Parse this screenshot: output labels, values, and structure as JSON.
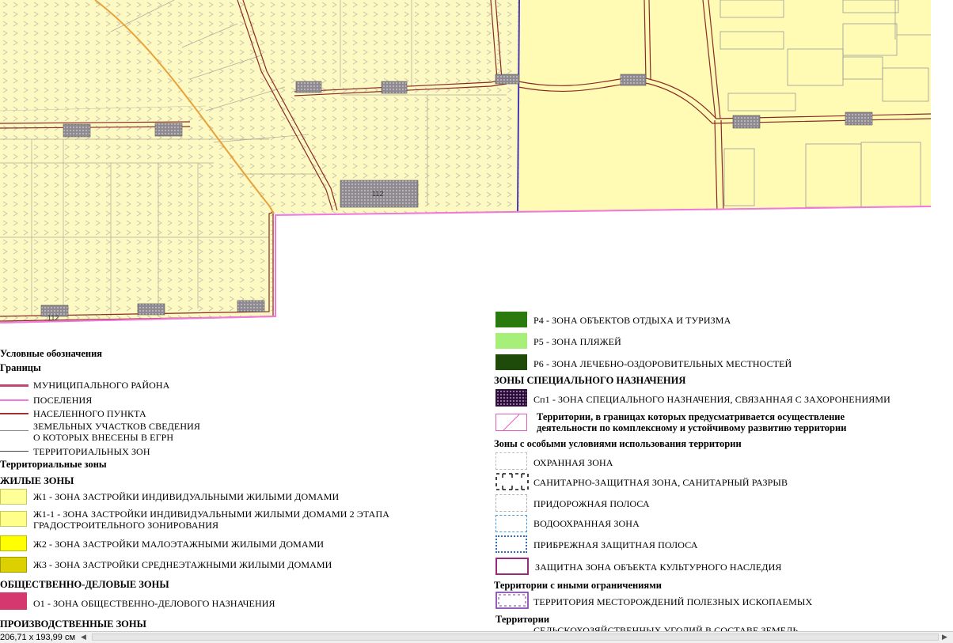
{
  "map": {
    "parcel_label_1": "112",
    "parcel_label_2": "112"
  },
  "legend": {
    "title": "Условные обозначения",
    "boundaries_heading": "Границы",
    "boundaries": [
      {
        "label": "МУНИЦИПАЛЬНОГО РАЙОНА",
        "color": "#c2466e"
      },
      {
        "label": "ПОСЕЛЕНИЯ",
        "color": "#f07ad8"
      },
      {
        "label": "НАСЕЛЕННОГО ПУНКТА",
        "color": "#a23030"
      },
      {
        "label": "ЗЕМЕЛЬНЫХ УЧАСТКОВ СВЕДЕНИЯ\nО КОТОРЫХ ВНЕСЕНЫ В ЕГРН",
        "color": "#888888"
      },
      {
        "label": "ТЕРРИТОРИАЛЬНЫХ ЗОН",
        "color": "#444444"
      }
    ],
    "territorial_heading": "Территориальные зоны",
    "residential_heading": "ЖИЛЫЕ ЗОНЫ",
    "residential": [
      {
        "label": "Ж1 - ЗОНА ЗАСТРОЙКИ ИНДИВИДУАЛЬНЫМИ ЖИЛЫМИ ДОМАМИ",
        "color": "#ffff99"
      },
      {
        "label": "Ж1-1 - ЗОНА ЗАСТРОЙКИ ИНДИВИДУАЛЬНЫМИ ЖИЛЫМИ ДОМАМИ 2 ЭТАПА\nГРАДОСТРОИТЕЛЬНОГО ЗОНИРОВАНИЯ",
        "color": "#ffff8a"
      },
      {
        "label": "Ж2 - ЗОНА ЗАСТРОЙКИ МАЛОЭТАЖНЫМИ ЖИЛЫМИ ДОМАМИ",
        "color": "#ffff00"
      },
      {
        "label": "Ж3 - ЗОНА ЗАСТРОЙКИ СРЕДНЕЭТАЖНЫМИ ЖИЛЫМИ ДОМАМИ",
        "color": "#dcd000"
      }
    ],
    "public_heading": "ОБЩЕСТВЕННО-ДЕЛОВЫЕ ЗОНЫ",
    "public": [
      {
        "label": "О1 - ЗОНА ОБЩЕСТВЕННО-ДЕЛОВОГО НАЗНАЧЕНИЯ",
        "color": "#d4386e"
      }
    ],
    "industrial_heading": "ПРОИЗВОДСТВЕННЫЕ ЗОНЫ",
    "recreation": [
      {
        "label": "Р4 - ЗОНА ОБЪЕКТОВ ОТДЫХА И ТУРИЗМА",
        "color": "#2a7a10"
      },
      {
        "label": "Р5 - ЗОНА ПЛЯЖЕЙ",
        "color": "#a6f07a"
      },
      {
        "label": "Р6 - ЗОНА ЛЕЧЕБНО-ОЗДОРОВИТЕЛЬНЫХ МЕСТНОСТЕЙ",
        "color": "#1e4a0a"
      }
    ],
    "special_heading": "ЗОНЫ СПЕЦИАЛЬНОГО НАЗНАЧЕНИЯ",
    "special": [
      {
        "label": "Сп1 - ЗОНА СПЕЦИАЛЬНОГО НАЗНАЧЕНИЯ, СВЯЗАННАЯ С ЗАХОРОНЕНИЯМИ",
        "color": "#6a2a6e"
      }
    ],
    "development_label": "Территории, в границах которых предусматривается осуществление\nдеятельности по комплексному и устойчивому развитию территории",
    "development_color": "#e060c0",
    "special_use_heading": "Зоны с особыми условиями использования территории",
    "special_use": [
      {
        "label": "ОХРАННАЯ ЗОНА",
        "color": "#bdbdbd"
      },
      {
        "label": "САНИТАРНО-ЗАЩИТНАЯ ЗОНА, САНИТАРНЫЙ РАЗРЫВ",
        "color": "#111111"
      },
      {
        "label": "ПРИДОРОЖНАЯ ПОЛОСА",
        "color": "#b0b0b0"
      },
      {
        "label": "ВОДООХРАННАЯ ЗОНА",
        "color": "#4a9ad8"
      },
      {
        "label": "ПРИБРЕЖНАЯ ЗАЩИТНАЯ ПОЛОСА",
        "color": "#2a6ac8"
      },
      {
        "label": "ЗАЩИТНА ЗОНА ОБЪЕКТА КУЛЬТУРНОГО НАСЛЕДИЯ",
        "color": "#9a2a7a"
      }
    ],
    "other_heading": "Территории с иными ограничениями",
    "other": [
      {
        "label": "ТЕРРИТОРИЯ МЕСТОРОЖДЕНИЙ ПОЛЕЗНЫХ ИСКОПАЕМЫХ",
        "color": "#7a3aa8"
      }
    ],
    "last_heading": "Территории",
    "last_item": "СЕЛЬСКОХОЗЯЙСТВЕННЫХ УГОДИЙ В СОСТАВЕ ЗЕМЕЛЬ"
  },
  "statusbar": {
    "dimensions": "206,71 x 193,99 см"
  }
}
